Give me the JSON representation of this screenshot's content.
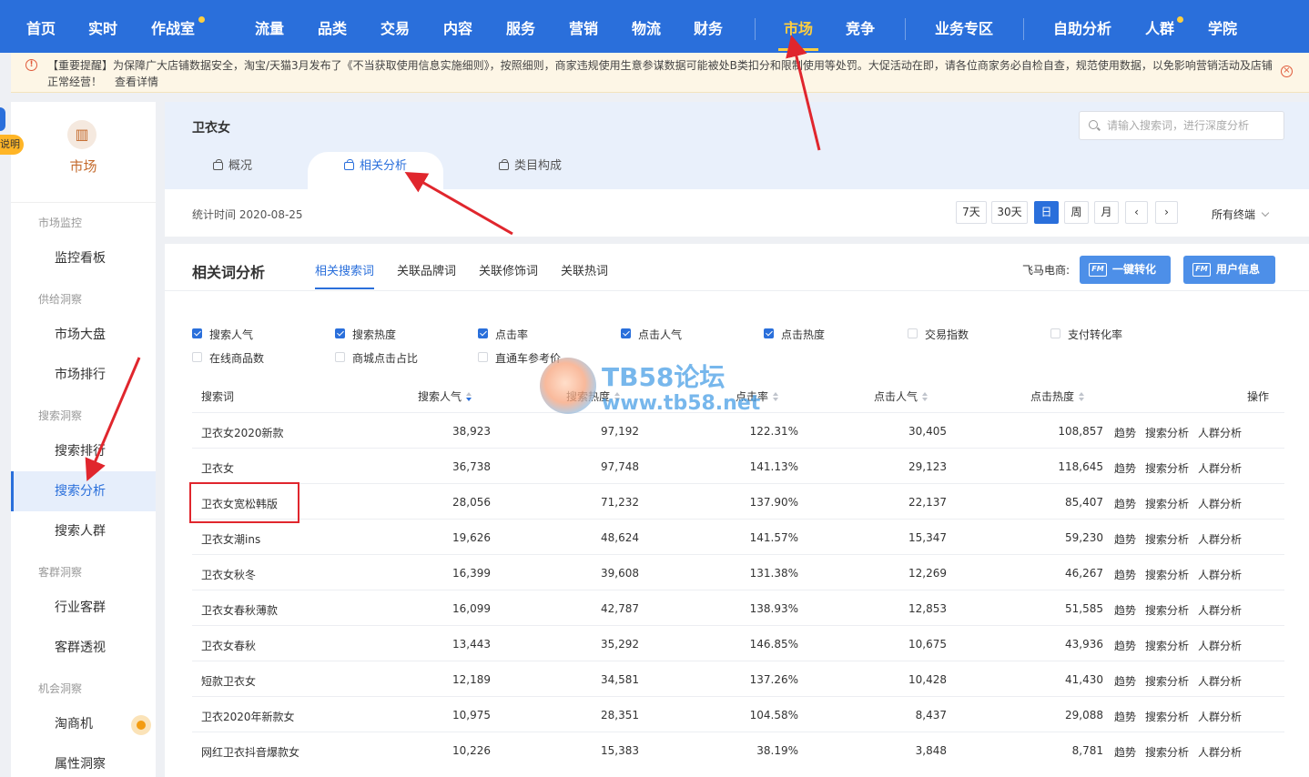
{
  "nav": {
    "items": [
      {
        "label": "首页"
      },
      {
        "label": "实时"
      },
      {
        "label": "作战室"
      },
      {
        "label": "流量"
      },
      {
        "label": "品类"
      },
      {
        "label": "交易"
      },
      {
        "label": "内容"
      },
      {
        "label": "服务"
      },
      {
        "label": "营销"
      },
      {
        "label": "物流"
      },
      {
        "label": "财务"
      },
      {
        "label": "市场"
      },
      {
        "label": "竞争"
      },
      {
        "label": "业务专区"
      },
      {
        "label": "自助分析"
      },
      {
        "label": "人群"
      },
      {
        "label": "学院"
      }
    ],
    "active": "市场"
  },
  "notice": {
    "text": "【重要提醒】为保障广大店铺数据安全，淘宝/天猫3月发布了《不当获取使用信息实施细则》，按照细则，商家违规使用生意参谋数据可能被处B类扣分和限制使用等处罚。大促活动在即，请各位商家务必自检自查，规范使用数据，以免影响营销活动及店铺正常经营！",
    "link": "查看详情"
  },
  "sidebar": {
    "side_tab": "说明",
    "title": "市场",
    "groups": {
      "monitor": "市场监控",
      "supply": "供给洞察",
      "search": "搜索洞察",
      "customer": "客群洞察",
      "chance": "机会洞察"
    },
    "items": {
      "dashboard": "监控看板",
      "market_overview": "市场大盘",
      "market_rank": "市场排行",
      "search_rank": "搜索排行",
      "search_analysis": "搜索分析",
      "search_crowd": "搜索人群",
      "industry_crowd": "行业客群",
      "crowd_insight": "客群透视",
      "taobao_chance": "淘商机",
      "attr_insight": "属性洞察"
    }
  },
  "header": {
    "keyword": "卫衣女",
    "search_placeholder": "请输入搜索词，进行深度分析",
    "tabs": {
      "overview": "概况",
      "related": "相关分析",
      "category": "类目构成"
    }
  },
  "timebar": {
    "stat_time": "统计时间 2020-08-25",
    "buttons": {
      "d7": "7天",
      "d30": "30天",
      "day": "日",
      "week": "周",
      "month": "月"
    },
    "terminal": "所有终端"
  },
  "main": {
    "title": "相关词分析",
    "subtabs": {
      "search": "相关搜索词",
      "brand": "关联品牌词",
      "modifier": "关联修饰词",
      "hot": "关联热词"
    },
    "feima_label": "飞马电商:",
    "btn_convert": "一键转化",
    "btn_userinfo": "用户信息",
    "checkboxes": [
      {
        "label": "搜索人气",
        "checked": true
      },
      {
        "label": "搜索热度",
        "checked": true
      },
      {
        "label": "点击率",
        "checked": true
      },
      {
        "label": "点击人气",
        "checked": true
      },
      {
        "label": "点击热度",
        "checked": true
      },
      {
        "label": "交易指数",
        "checked": false
      },
      {
        "label": "支付转化率",
        "checked": false
      },
      {
        "label": "在线商品数",
        "checked": false
      },
      {
        "label": "商城点击占比",
        "checked": false
      },
      {
        "label": "直通车参考价",
        "checked": false
      }
    ],
    "columns": {
      "word": "搜索词",
      "pop": "搜索人气",
      "heat": "搜索热度",
      "ctr": "点击率",
      "click_pop": "点击人气",
      "click_heat": "点击热度",
      "ops": "操作"
    },
    "row_actions": {
      "trend": "趋势",
      "search": "搜索分析",
      "crowd": "人群分析"
    },
    "rows": [
      {
        "word": "卫衣女2020新款",
        "pop": "38,923",
        "heat": "97,192",
        "ctr": "122.31%",
        "click_pop": "30,405",
        "click_heat": "108,857"
      },
      {
        "word": "卫衣女",
        "pop": "36,738",
        "heat": "97,748",
        "ctr": "141.13%",
        "click_pop": "29,123",
        "click_heat": "118,645"
      },
      {
        "word": "卫衣女宽松韩版",
        "pop": "28,056",
        "heat": "71,232",
        "ctr": "137.90%",
        "click_pop": "22,137",
        "click_heat": "85,407"
      },
      {
        "word": "卫衣女潮ins",
        "pop": "19,626",
        "heat": "48,624",
        "ctr": "141.57%",
        "click_pop": "15,347",
        "click_heat": "59,230"
      },
      {
        "word": "卫衣女秋冬",
        "pop": "16,399",
        "heat": "39,608",
        "ctr": "131.38%",
        "click_pop": "12,269",
        "click_heat": "46,267"
      },
      {
        "word": "卫衣女春秋薄款",
        "pop": "16,099",
        "heat": "42,787",
        "ctr": "138.93%",
        "click_pop": "12,853",
        "click_heat": "51,585"
      },
      {
        "word": "卫衣女春秋",
        "pop": "13,443",
        "heat": "35,292",
        "ctr": "146.85%",
        "click_pop": "10,675",
        "click_heat": "43,936"
      },
      {
        "word": "短款卫衣女",
        "pop": "12,189",
        "heat": "34,581",
        "ctr": "137.26%",
        "click_pop": "10,428",
        "click_heat": "41,430"
      },
      {
        "word": "卫衣2020年新款女",
        "pop": "10,975",
        "heat": "28,351",
        "ctr": "104.58%",
        "click_pop": "8,437",
        "click_heat": "29,088"
      },
      {
        "word": "网红卫衣抖音爆款女",
        "pop": "10,226",
        "heat": "15,383",
        "ctr": "38.19%",
        "click_pop": "3,848",
        "click_heat": "8,781"
      }
    ]
  },
  "watermark": {
    "line1": "TB58论坛",
    "line2": "www.tb58.net"
  },
  "colors": {
    "brand": "#2a6fdb",
    "accent": "#ffcf3f",
    "annotation": "#e0262d",
    "market": "#c46a2c"
  }
}
